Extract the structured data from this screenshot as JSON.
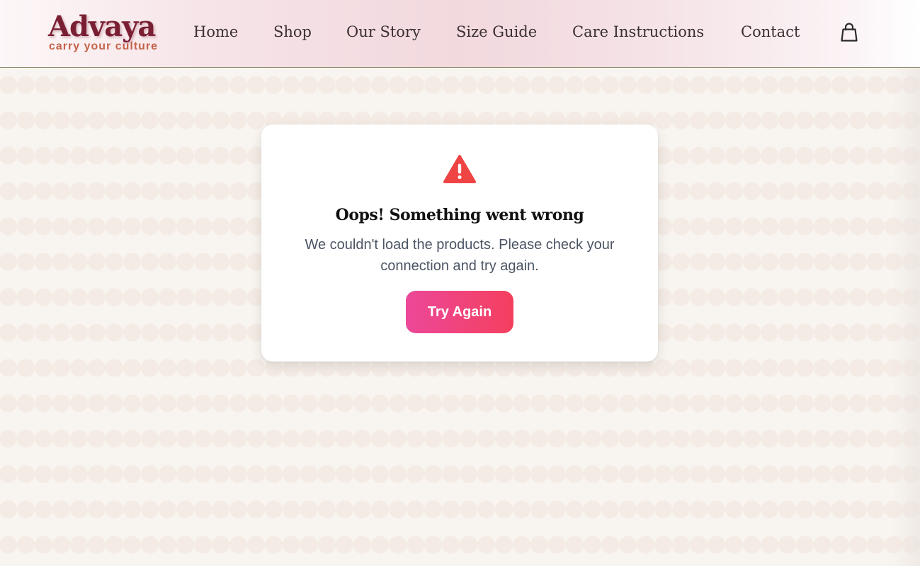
{
  "brand": {
    "name": "Advaya",
    "tagline": "carry your culture"
  },
  "nav": {
    "items": [
      {
        "label": "Home"
      },
      {
        "label": "Shop"
      },
      {
        "label": "Our Story"
      },
      {
        "label": "Size Guide"
      },
      {
        "label": "Care Instructions"
      },
      {
        "label": "Contact"
      }
    ],
    "cart_icon": "shopping-bag-icon"
  },
  "error": {
    "icon": "warning-triangle-icon",
    "title": "Oops! Something went wrong",
    "message": "We couldn't load the products. Please check your connection and try again.",
    "button_label": "Try Again"
  },
  "colors": {
    "brand": "#7a1f33",
    "tagline": "#c4634a",
    "warning": "#ef4444",
    "button_start": "#ec4899",
    "button_end": "#f43f5e",
    "background": "#f8f4f0"
  }
}
